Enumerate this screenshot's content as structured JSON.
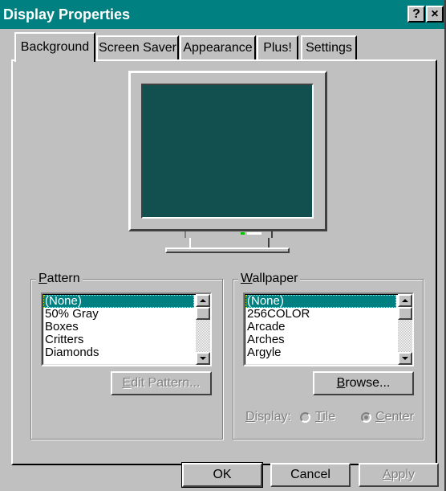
{
  "window": {
    "title": "Display Properties",
    "help_label": "?",
    "close_label": "×"
  },
  "tabs": [
    {
      "label": "Background"
    },
    {
      "label": "Screen Saver"
    },
    {
      "label": "Appearance"
    },
    {
      "label": "Plus!"
    },
    {
      "label": "Settings"
    }
  ],
  "pattern": {
    "label_first": "P",
    "label_rest": "attern",
    "items": [
      "(None)",
      "50% Gray",
      "Boxes",
      "Critters",
      "Diamonds"
    ],
    "selected": "(None)",
    "edit_label_first": "E",
    "edit_label_rest": "dit Pattern..."
  },
  "wallpaper": {
    "label_first": "W",
    "label_rest": "allpaper",
    "items": [
      "(None)",
      "256COLOR",
      "Arcade",
      "Arches",
      "Argyle"
    ],
    "selected": "(None)",
    "browse_label_first": "B",
    "browse_label_rest": "rowse...",
    "display_label": "Display:",
    "tile_first": "T",
    "tile_rest": "ile",
    "center_first": "C",
    "center_rest": "enter",
    "display_value": "Center"
  },
  "footer": {
    "ok": "OK",
    "cancel": "Cancel",
    "apply_first": "A",
    "apply_rest": "pply"
  },
  "colors": {
    "titlebar": "#008080",
    "desktop": "#0f4848",
    "face": "#c0c0c0",
    "selection": "#008080"
  }
}
